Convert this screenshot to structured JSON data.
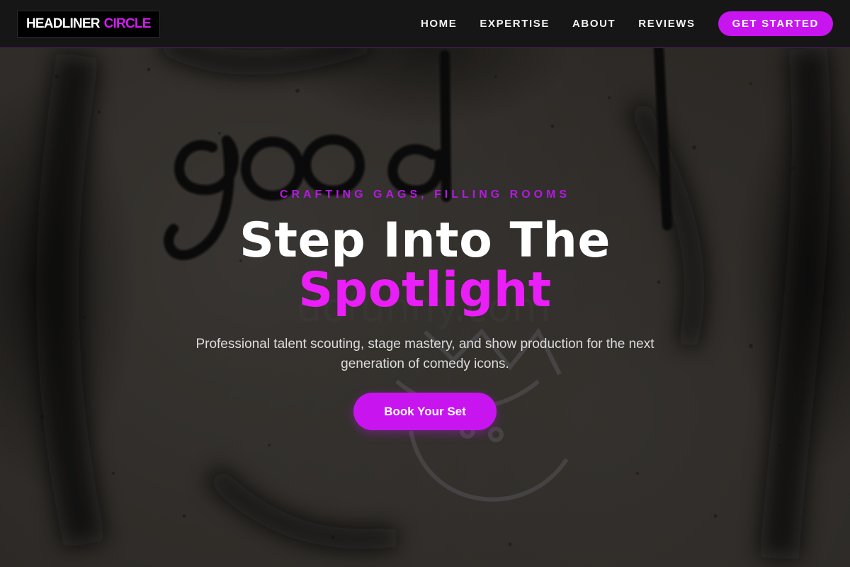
{
  "brand": {
    "word1": "HEADLINER",
    "word2": "CIRCLE",
    "accent_color": "#c815f0"
  },
  "nav": {
    "links": [
      "HOME",
      "EXPERTISE",
      "ABOUT",
      "REVIEWS"
    ],
    "cta": "GET STARTED"
  },
  "hero": {
    "eyebrow": "CRAFTING GAGS, FILLING ROOMS",
    "title_line1": "Step Into The",
    "title_line2": "Spotlight",
    "subtitle": "Professional talent scouting, stage mastery, and show production for the next generation of comedy icons.",
    "cta": "Book Your Set",
    "background": "textured concrete wall with graffiti"
  }
}
